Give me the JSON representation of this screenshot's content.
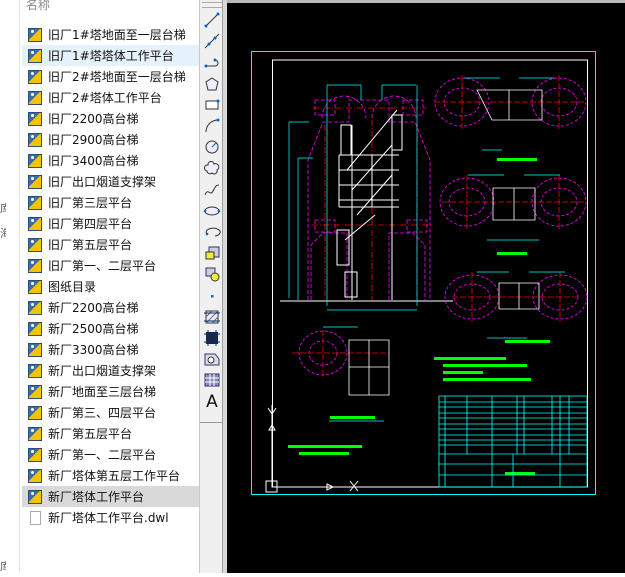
{
  "file_panel": {
    "header": "名称",
    "items": [
      {
        "label": "旧厂1#塔地面至一层台梯",
        "type": "dwg"
      },
      {
        "label": "旧厂1#塔塔体工作平台",
        "type": "dwg",
        "state": "hover"
      },
      {
        "label": "旧厂2#塔地面至一层台梯",
        "type": "dwg"
      },
      {
        "label": "旧厂2#塔体工作平台",
        "type": "dwg"
      },
      {
        "label": "旧厂2200高台梯",
        "type": "dwg"
      },
      {
        "label": "旧厂2900高台梯",
        "type": "dwg"
      },
      {
        "label": "旧厂3400高台梯",
        "type": "dwg"
      },
      {
        "label": "旧厂出口烟道支撑架",
        "type": "dwg"
      },
      {
        "label": "旧厂第三层平台",
        "type": "dwg"
      },
      {
        "label": "旧厂第四层平台",
        "type": "dwg"
      },
      {
        "label": "旧厂第五层平台",
        "type": "dwg"
      },
      {
        "label": "旧厂第一、二层平台",
        "type": "dwg"
      },
      {
        "label": "图纸目录",
        "type": "dwg"
      },
      {
        "label": "新厂2200高台梯",
        "type": "dwg"
      },
      {
        "label": "新厂2500高台梯",
        "type": "dwg"
      },
      {
        "label": "新厂3300高台梯",
        "type": "dwg"
      },
      {
        "label": "新厂出口烟道支撑架",
        "type": "dwg"
      },
      {
        "label": "新厂地面至三层台梯",
        "type": "dwg"
      },
      {
        "label": "新厂第三、四层平台",
        "type": "dwg"
      },
      {
        "label": "新厂第五层平台",
        "type": "dwg"
      },
      {
        "label": "新厂第一、二层平台",
        "type": "dwg"
      },
      {
        "label": "新厂塔体第五层工作平台",
        "type": "dwg"
      },
      {
        "label": "新厂塔体工作平台",
        "type": "dwg",
        "state": "selected"
      },
      {
        "label": "新厂塔体工作平台.dwl",
        "type": "file"
      }
    ]
  },
  "left_strip_fragments": [
    "库",
    "海",
    "库"
  ],
  "draw_toolbar": [
    "line-icon",
    "construction-line-icon",
    "polyline-icon",
    "polygon-icon",
    "rectangle-icon",
    "arc-icon",
    "circle-icon",
    "revision-cloud-icon",
    "spline-icon",
    "ellipse-icon",
    "ellipse-arc-icon",
    "insert-block-icon",
    "make-block-icon",
    "point-icon",
    "hatch-icon",
    "gradient-icon",
    "region-icon",
    "table-icon",
    "multiline-text-icon"
  ],
  "toolbar_text_glyph": "A",
  "drawing_colors": {
    "frame": "#00ffff",
    "border": "#ffffff",
    "outline": "#ff00ff",
    "center": "#ff0000",
    "dim": "#00ffff",
    "text": "#00ff00",
    "steel": "#ffffff"
  }
}
